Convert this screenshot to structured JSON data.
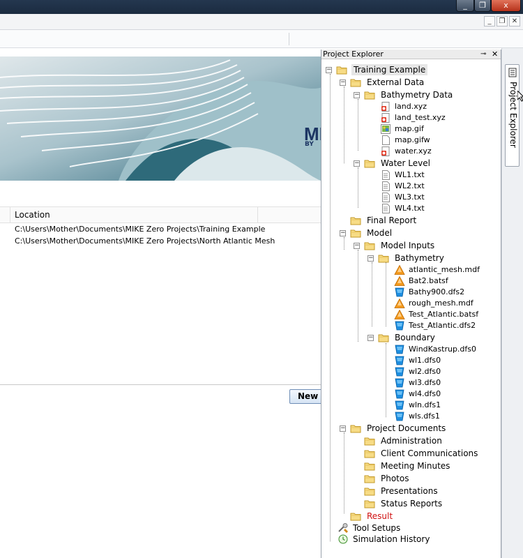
{
  "window": {
    "minimize": "_",
    "restore": "❐",
    "close": "x"
  },
  "mdi": {
    "minimize": "_",
    "restore": "❐",
    "close": "✕"
  },
  "banner": {
    "brand": "MI",
    "sub": "BY"
  },
  "recent": {
    "column_location": "Location",
    "rows": [
      "C:\\Users\\Mother\\Documents\\MIKE Zero Projects\\Training Example",
      "C:\\Users\\Mother\\Documents\\MIKE Zero Projects\\North Atlantic Mesh"
    ],
    "new_button": "New P"
  },
  "explorer": {
    "title": "Project Explorer",
    "pin": "⊸",
    "close": "✕",
    "tab_label": "Project Explorer",
    "tree": {
      "root": "Training Example",
      "external_data": "External Data",
      "bathymetry_data": "Bathymetry Data",
      "land_xyz": "land.xyz",
      "land_test_xyz": "land_test.xyz",
      "map_gif": "map.gif",
      "map_gifw": "map.gifw",
      "water_xyz": "water.xyz",
      "water_level": "Water Level",
      "wl1": "WL1.txt",
      "wl2": "WL2.txt",
      "wl3": "WL3.txt",
      "wl4": "WL4.txt",
      "final_report": "Final Report",
      "model": "Model",
      "model_inputs": "Model Inputs",
      "bathymetry": "Bathymetry",
      "atlantic_mesh": "atlantic_mesh.mdf",
      "bat2": "Bat2.batsf",
      "bathy900": "Bathy900.dfs2",
      "rough_mesh": "rough_mesh.mdf",
      "test_atlantic_batsf": "Test_Atlantic.batsf",
      "test_atlantic_dfs2": "Test_Atlantic.dfs2",
      "boundary": "Boundary",
      "windkastrup": "WindKastrup.dfs0",
      "wl1_dfs0": "wl1.dfs0",
      "wl2_dfs0": "wl2.dfs0",
      "wl3_dfs0": "wl3.dfs0",
      "wl4_dfs0": "wl4.dfs0",
      "wln_dfs1": "wln.dfs1",
      "wls_dfs1": "wls.dfs1",
      "project_documents": "Project Documents",
      "administration": "Administration",
      "client_communications": "Client Communications",
      "meeting_minutes": "Meeting Minutes",
      "photos": "Photos",
      "presentations": "Presentations",
      "status_reports": "Status Reports",
      "result": "Result",
      "tool_setups": "Tool Setups",
      "simulation_history": "Simulation History"
    }
  },
  "colors": {
    "folder": "#f5d77a",
    "result_text": "#d01010",
    "triangle": "#f39a1e",
    "dfs": "#1d8ee0"
  }
}
